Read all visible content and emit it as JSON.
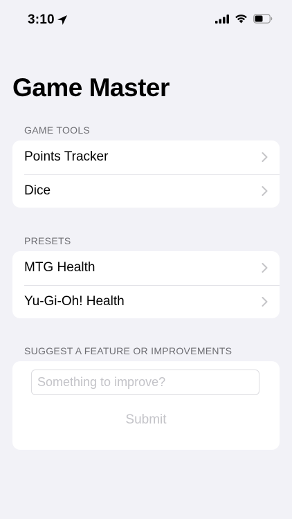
{
  "status_bar": {
    "time": "3:10",
    "location_icon": "location-arrow-icon",
    "signal_icon": "cellular-signal-icon",
    "wifi_icon": "wifi-icon",
    "battery_icon": "battery-icon",
    "battery_level": 0.55
  },
  "page": {
    "title": "Game Master"
  },
  "sections": {
    "game_tools": {
      "header": "GAME TOOLS",
      "items": [
        {
          "label": "Points Tracker",
          "icon": "chevron-right-icon"
        },
        {
          "label": "Dice",
          "icon": "chevron-right-icon"
        }
      ]
    },
    "presets": {
      "header": "PRESETS",
      "items": [
        {
          "label": "MTG Health",
          "icon": "chevron-right-icon"
        },
        {
          "label": "Yu-Gi-Oh! Health",
          "icon": "chevron-right-icon"
        }
      ]
    },
    "suggest": {
      "header": "SUGGEST A FEATURE OR IMPROVEMENTS",
      "input_value": "",
      "input_placeholder": "Something to improve?",
      "submit_label": "Submit"
    }
  },
  "colors": {
    "background": "#f2f2f7",
    "cell": "#ffffff",
    "secondary_text": "#6d6d72",
    "disabled_text": "#c3c3c8",
    "chevron": "#c4c4c7"
  }
}
